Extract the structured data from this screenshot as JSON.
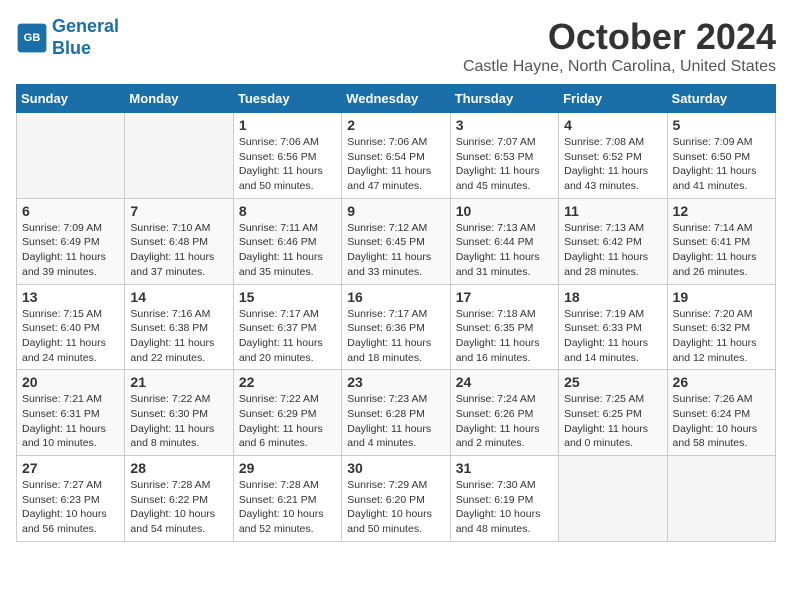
{
  "logo": {
    "line1": "General",
    "line2": "Blue"
  },
  "title": "October 2024",
  "location": "Castle Hayne, North Carolina, United States",
  "days_of_week": [
    "Sunday",
    "Monday",
    "Tuesday",
    "Wednesday",
    "Thursday",
    "Friday",
    "Saturday"
  ],
  "weeks": [
    [
      {
        "day": "",
        "info": ""
      },
      {
        "day": "",
        "info": ""
      },
      {
        "day": "1",
        "info": "Sunrise: 7:06 AM\nSunset: 6:56 PM\nDaylight: 11 hours and 50 minutes."
      },
      {
        "day": "2",
        "info": "Sunrise: 7:06 AM\nSunset: 6:54 PM\nDaylight: 11 hours and 47 minutes."
      },
      {
        "day": "3",
        "info": "Sunrise: 7:07 AM\nSunset: 6:53 PM\nDaylight: 11 hours and 45 minutes."
      },
      {
        "day": "4",
        "info": "Sunrise: 7:08 AM\nSunset: 6:52 PM\nDaylight: 11 hours and 43 minutes."
      },
      {
        "day": "5",
        "info": "Sunrise: 7:09 AM\nSunset: 6:50 PM\nDaylight: 11 hours and 41 minutes."
      }
    ],
    [
      {
        "day": "6",
        "info": "Sunrise: 7:09 AM\nSunset: 6:49 PM\nDaylight: 11 hours and 39 minutes."
      },
      {
        "day": "7",
        "info": "Sunrise: 7:10 AM\nSunset: 6:48 PM\nDaylight: 11 hours and 37 minutes."
      },
      {
        "day": "8",
        "info": "Sunrise: 7:11 AM\nSunset: 6:46 PM\nDaylight: 11 hours and 35 minutes."
      },
      {
        "day": "9",
        "info": "Sunrise: 7:12 AM\nSunset: 6:45 PM\nDaylight: 11 hours and 33 minutes."
      },
      {
        "day": "10",
        "info": "Sunrise: 7:13 AM\nSunset: 6:44 PM\nDaylight: 11 hours and 31 minutes."
      },
      {
        "day": "11",
        "info": "Sunrise: 7:13 AM\nSunset: 6:42 PM\nDaylight: 11 hours and 28 minutes."
      },
      {
        "day": "12",
        "info": "Sunrise: 7:14 AM\nSunset: 6:41 PM\nDaylight: 11 hours and 26 minutes."
      }
    ],
    [
      {
        "day": "13",
        "info": "Sunrise: 7:15 AM\nSunset: 6:40 PM\nDaylight: 11 hours and 24 minutes."
      },
      {
        "day": "14",
        "info": "Sunrise: 7:16 AM\nSunset: 6:38 PM\nDaylight: 11 hours and 22 minutes."
      },
      {
        "day": "15",
        "info": "Sunrise: 7:17 AM\nSunset: 6:37 PM\nDaylight: 11 hours and 20 minutes."
      },
      {
        "day": "16",
        "info": "Sunrise: 7:17 AM\nSunset: 6:36 PM\nDaylight: 11 hours and 18 minutes."
      },
      {
        "day": "17",
        "info": "Sunrise: 7:18 AM\nSunset: 6:35 PM\nDaylight: 11 hours and 16 minutes."
      },
      {
        "day": "18",
        "info": "Sunrise: 7:19 AM\nSunset: 6:33 PM\nDaylight: 11 hours and 14 minutes."
      },
      {
        "day": "19",
        "info": "Sunrise: 7:20 AM\nSunset: 6:32 PM\nDaylight: 11 hours and 12 minutes."
      }
    ],
    [
      {
        "day": "20",
        "info": "Sunrise: 7:21 AM\nSunset: 6:31 PM\nDaylight: 11 hours and 10 minutes."
      },
      {
        "day": "21",
        "info": "Sunrise: 7:22 AM\nSunset: 6:30 PM\nDaylight: 11 hours and 8 minutes."
      },
      {
        "day": "22",
        "info": "Sunrise: 7:22 AM\nSunset: 6:29 PM\nDaylight: 11 hours and 6 minutes."
      },
      {
        "day": "23",
        "info": "Sunrise: 7:23 AM\nSunset: 6:28 PM\nDaylight: 11 hours and 4 minutes."
      },
      {
        "day": "24",
        "info": "Sunrise: 7:24 AM\nSunset: 6:26 PM\nDaylight: 11 hours and 2 minutes."
      },
      {
        "day": "25",
        "info": "Sunrise: 7:25 AM\nSunset: 6:25 PM\nDaylight: 11 hours and 0 minutes."
      },
      {
        "day": "26",
        "info": "Sunrise: 7:26 AM\nSunset: 6:24 PM\nDaylight: 10 hours and 58 minutes."
      }
    ],
    [
      {
        "day": "27",
        "info": "Sunrise: 7:27 AM\nSunset: 6:23 PM\nDaylight: 10 hours and 56 minutes."
      },
      {
        "day": "28",
        "info": "Sunrise: 7:28 AM\nSunset: 6:22 PM\nDaylight: 10 hours and 54 minutes."
      },
      {
        "day": "29",
        "info": "Sunrise: 7:28 AM\nSunset: 6:21 PM\nDaylight: 10 hours and 52 minutes."
      },
      {
        "day": "30",
        "info": "Sunrise: 7:29 AM\nSunset: 6:20 PM\nDaylight: 10 hours and 50 minutes."
      },
      {
        "day": "31",
        "info": "Sunrise: 7:30 AM\nSunset: 6:19 PM\nDaylight: 10 hours and 48 minutes."
      },
      {
        "day": "",
        "info": ""
      },
      {
        "day": "",
        "info": ""
      }
    ]
  ]
}
